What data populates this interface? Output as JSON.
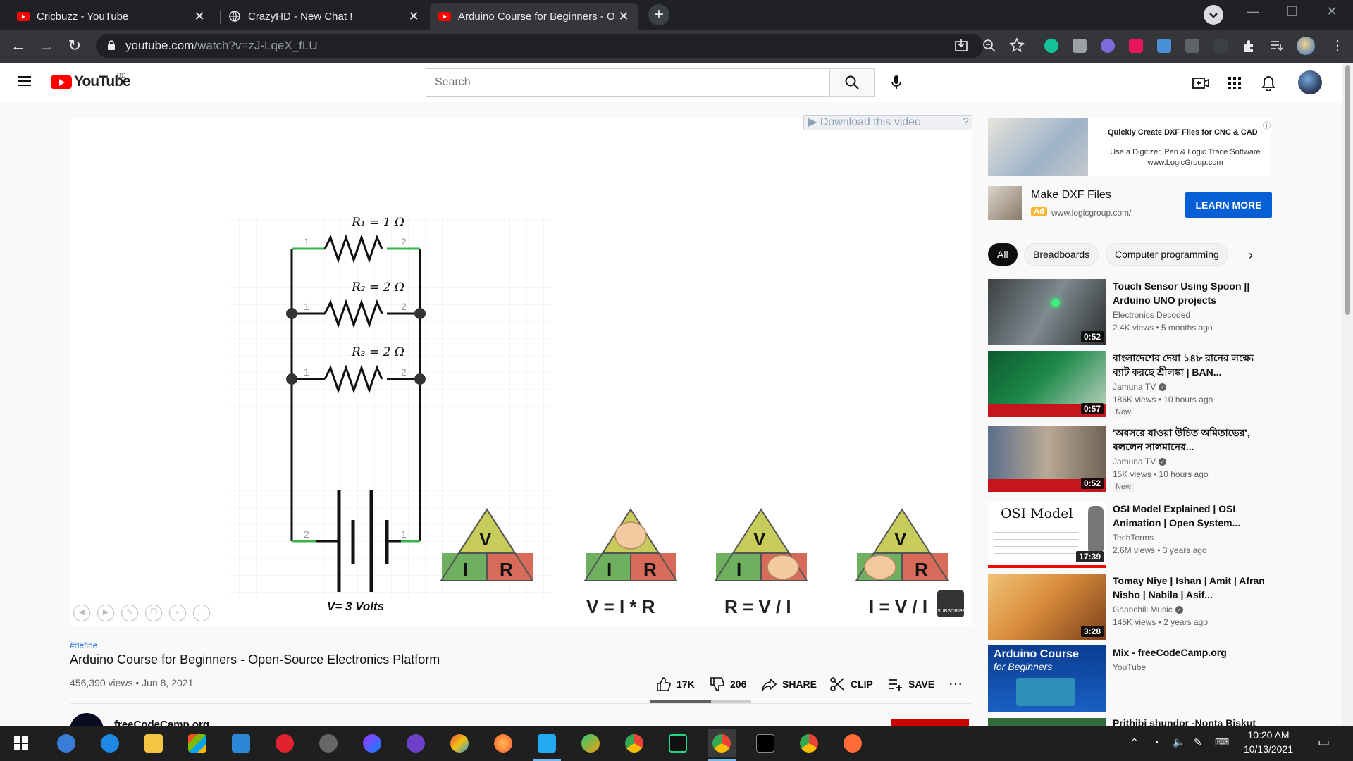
{
  "browser": {
    "tabs": [
      {
        "title": "Cricbuzz - YouTube",
        "icon": "youtube-icon"
      },
      {
        "title": "CrazyHD - New Chat !",
        "icon": "globe-icon"
      },
      {
        "title": "Arduino Course for Beginners - O",
        "icon": "youtube-icon",
        "active": true
      }
    ],
    "url_domain": "youtube.com",
    "url_path": "/watch?v=zJ-LqeX_fLU"
  },
  "youtube": {
    "country": "BD",
    "search_placeholder": "Search"
  },
  "player": {
    "download_banner": "Download this video",
    "download_help": "?",
    "circuit": {
      "r1": "R₁ = 1 Ω",
      "r2": "R₂ = 2 Ω",
      "r3": "R₃ = 2 Ω",
      "pin1": "1",
      "pin2": "2",
      "voltage": "V= 3 Volts"
    },
    "triangles": {
      "v": "V",
      "i": "I",
      "r": "R",
      "f1": "V = I * R",
      "f2": "R = V / I",
      "f3": "I = V / I"
    },
    "badge": "SUBSCRIBE"
  },
  "video": {
    "hashtag": "#define",
    "title": "Arduino Course for Beginners - Open-Source Electronics Platform",
    "views_date": "456,390 views • Jun 8, 2021",
    "likes": "17K",
    "dislikes": "206",
    "share": "SHARE",
    "clip": "CLIP",
    "save": "SAVE",
    "channel": "freeCodeCamp.org"
  },
  "ad": {
    "banner_line1": "Quickly Create DXF Files for CNC & CAD",
    "banner_line2": "Use a Digitizer, Pen & Logic Trace Software",
    "banner_line3": "www.LogicGroup.com",
    "title": "Make DXF Files",
    "tag": "Ad",
    "url": "www.logicgroup.com/",
    "cta": "LEARN MORE"
  },
  "chips": [
    "All",
    "Breadboards",
    "Computer programming"
  ],
  "recommendations": [
    {
      "title": "Touch Sensor Using Spoon || Arduino UNO projects",
      "channel": "Electronics Decoded",
      "meta": "2.4K views • 5 months ago",
      "duration": "0:52",
      "new": "",
      "verified": false
    },
    {
      "title": "বাংলাদেশের দেয়া ১৪৮ রানের লক্ষ্যে ব্যাট করছে শ্রীলঙ্কা | BAN...",
      "channel": "Jamuna TV",
      "meta": "186K views • 10 hours ago",
      "duration": "0:57",
      "new": "New",
      "verified": true
    },
    {
      "title": "'অবসরে যাওয়া উচিত অমিতাভের', বললেন সালমানের...",
      "channel": "Jamuna TV",
      "meta": "15K views • 10 hours ago",
      "duration": "0:52",
      "new": "New",
      "verified": true
    },
    {
      "title": "OSI Model Explained | OSI Animation | Open System...",
      "channel": "TechTerms",
      "meta": "2.6M views • 3 years ago",
      "duration": "17:39",
      "new": "",
      "verified": false
    },
    {
      "title": "Tomay Niye | Ishan | Amit | Afran Nisho | Nabila | Asif...",
      "channel": "Gaanchill Music",
      "meta": "145K views • 2 years ago",
      "duration": "3:28",
      "new": "",
      "verified": true
    },
    {
      "title": "Mix - freeCodeCamp.org",
      "channel": "YouTube",
      "meta": "",
      "duration": "",
      "new": "",
      "verified": false
    },
    {
      "title": "Prithibi shundor -Nonta Biskut",
      "channel": "",
      "meta": "",
      "duration": "",
      "new": "",
      "verified": false
    }
  ],
  "rec_thumbs": {
    "osi_title": "OSI Model",
    "mix_title": "Arduino Course",
    "mix_sub": "for Beginners"
  },
  "taskbar": {
    "time": "10:20 AM",
    "date": "10/13/2021"
  }
}
